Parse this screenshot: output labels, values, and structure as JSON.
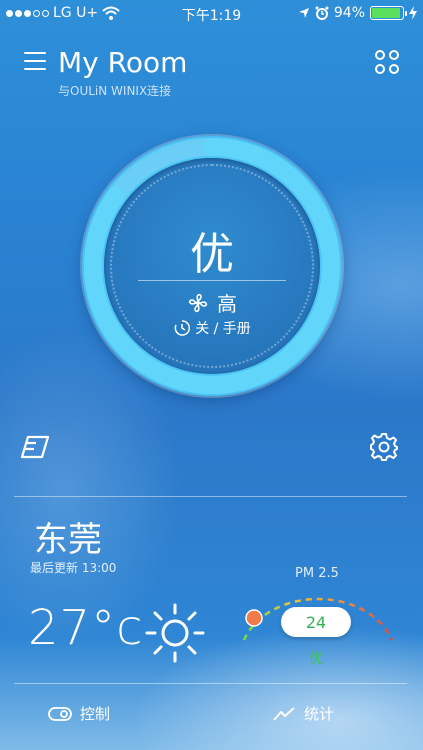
{
  "status_bar": {
    "carrier": "LG U+",
    "time": "下午1:19",
    "battery": "94%",
    "battery_level": 0.94
  },
  "header": {
    "title": "My Room",
    "subtitle": "与OULiN WINIX连接"
  },
  "dial": {
    "air_quality": "优",
    "fan_speed": "高",
    "timer_text": "关 / 手册",
    "progress": 0.85
  },
  "weather": {
    "city": "东莞",
    "updated": "最后更新 13:00",
    "temperature": "27°c",
    "pm_label": "PM 2.5",
    "pm_value": "24",
    "pm_quality": "优"
  },
  "bottom_bar": {
    "control_label": "控制",
    "stats_label": "统计"
  }
}
